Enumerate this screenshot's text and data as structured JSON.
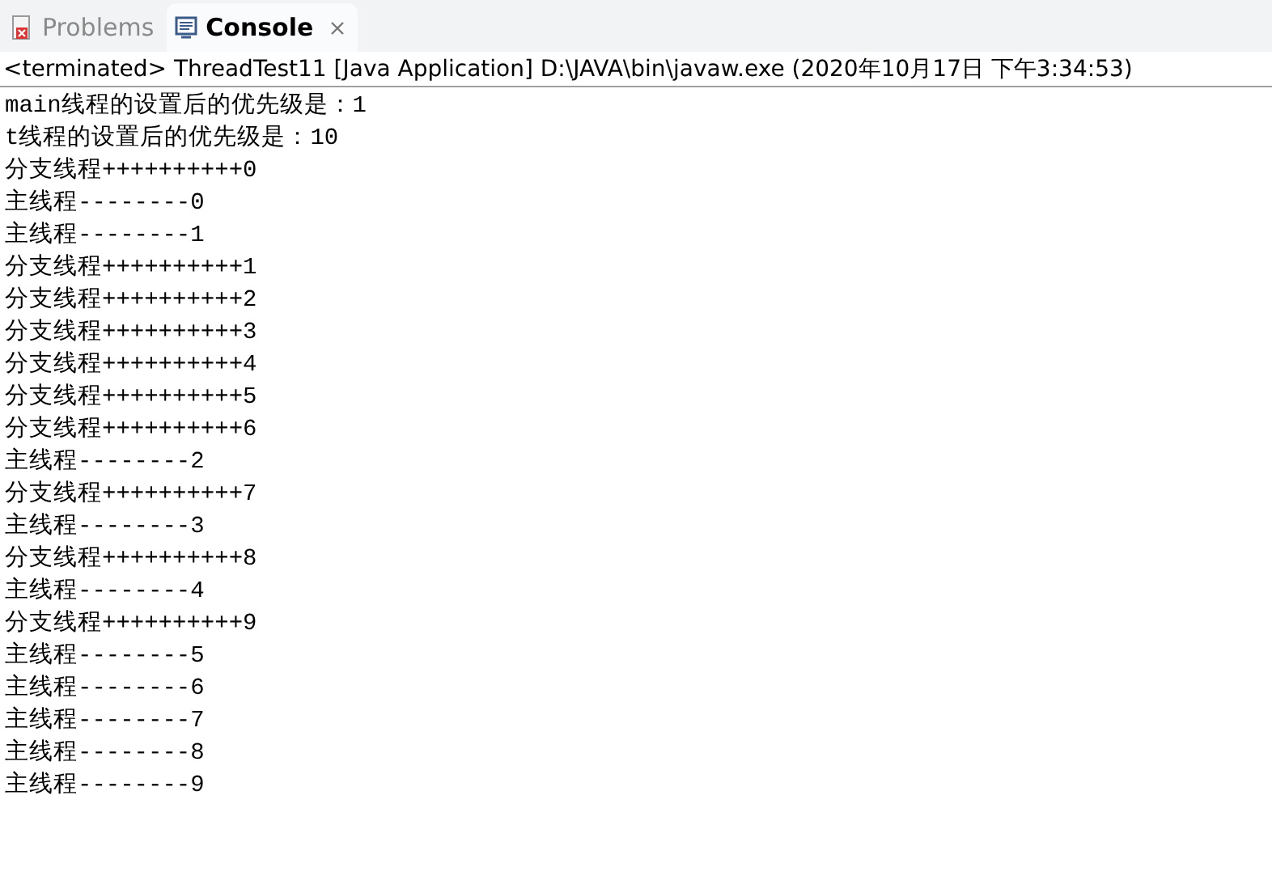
{
  "tabs": [
    {
      "label": "Problems",
      "selected": false,
      "closable": false
    },
    {
      "label": "Console",
      "selected": true,
      "closable": true
    }
  ],
  "console": {
    "header": "<terminated> ThreadTest11 [Java Application] D:\\JAVA\\bin\\javaw.exe (2020年10月17日 下午3:34:53)",
    "lines": [
      "main线程的设置后的优先级是：1",
      "t线程的设置后的优先级是：10",
      "分支线程++++++++++0",
      "主线程--------0",
      "主线程--------1",
      "分支线程++++++++++1",
      "分支线程++++++++++2",
      "分支线程++++++++++3",
      "分支线程++++++++++4",
      "分支线程++++++++++5",
      "分支线程++++++++++6",
      "主线程--------2",
      "分支线程++++++++++7",
      "主线程--------3",
      "分支线程++++++++++8",
      "主线程--------4",
      "分支线程++++++++++9",
      "主线程--------5",
      "主线程--------6",
      "主线程--------7",
      "主线程--------8",
      "主线程--------9"
    ]
  }
}
